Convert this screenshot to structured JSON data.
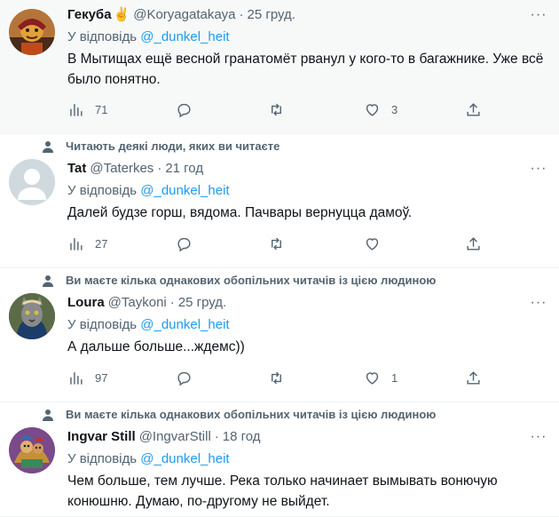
{
  "tweets": [
    {
      "social_context": "",
      "author": {
        "name": "Гекуба",
        "emoji": "✌️",
        "handle": "@Koryagatakaya",
        "time": "25 груд."
      },
      "reply_prefix": "У відповідь",
      "reply_to": "@_dunkel_heit",
      "text": "В Мытищах ещё весной гранатомёт рванул у кого-то в багажнике. Уже всё было понятно.",
      "stats": {
        "views": "71",
        "replies": "",
        "retweets": "",
        "likes": "3"
      }
    },
    {
      "social_context": "Читають деякі люди, яких ви читаєте",
      "author": {
        "name": "Tat",
        "emoji": "",
        "handle": "@Taterkes",
        "time": "21 год"
      },
      "reply_prefix": "У відповідь",
      "reply_to": "@_dunkel_heit",
      "text": "Далей будзе горш, вядома. Пачвары вернуцца дамоў.",
      "stats": {
        "views": "27",
        "replies": "",
        "retweets": "",
        "likes": ""
      }
    },
    {
      "social_context": "Ви маєте кілька однакових обопільних читачів із цією людиною",
      "author": {
        "name": "Loura",
        "emoji": "",
        "handle": "@Taykoni",
        "time": "25 груд."
      },
      "reply_prefix": "У відповідь",
      "reply_to": "@_dunkel_heit",
      "text": "А дальше больше...ждемс))",
      "stats": {
        "views": "97",
        "replies": "",
        "retweets": "",
        "likes": "1"
      }
    },
    {
      "social_context": "Ви маєте кілька однакових обопільних читачів із цією людиною",
      "author": {
        "name": "Ingvar Still",
        "emoji": "",
        "handle": "@IngvarStill",
        "time": "18 год"
      },
      "reply_prefix": "У відповідь",
      "reply_to": "@_dunkel_heit",
      "text": "Чем больше, тем лучше. Река только начинает вымывать вонючую конюшню. Думаю, по-другому не выйдет.",
      "stats": {
        "views": "",
        "replies": "",
        "retweets": "",
        "likes": ""
      }
    }
  ],
  "separator": "·",
  "more_label": "···",
  "icons": {
    "views": "bar-chart-icon",
    "reply": "speech-bubble-icon",
    "retweet": "retweet-icon",
    "like": "heart-icon",
    "share": "share-upload-icon",
    "social": "person-icon",
    "more": "ellipsis-icon"
  },
  "colors": {
    "link": "#1d9bf0",
    "secondary_text": "#536471",
    "primary_text": "#0f1419",
    "highlight_bg": "#f7f9f9"
  }
}
